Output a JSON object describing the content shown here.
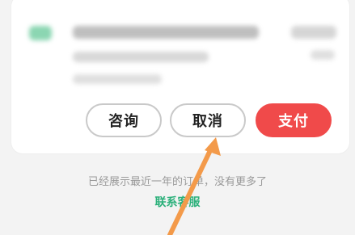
{
  "order": {
    "actions": {
      "consult_label": "咨询",
      "cancel_label": "取消",
      "pay_label": "支付"
    }
  },
  "footer": {
    "notice": "已经展示最近一年的订单，没有更多了",
    "contact_link": "联系客服"
  },
  "colors": {
    "accent_green": "#2bb07a",
    "pay_red": "#f04a4a",
    "arrow_orange": "#f39a4a"
  },
  "icons": {
    "annotation": "arrow-up-icon"
  }
}
